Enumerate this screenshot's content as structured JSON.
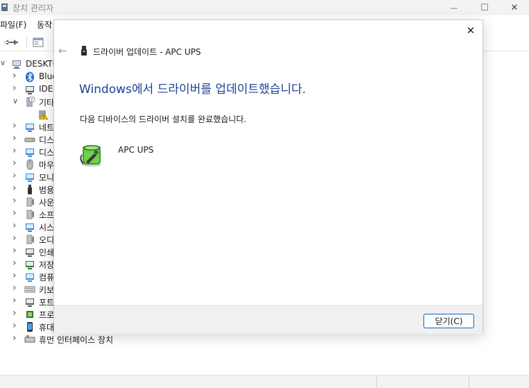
{
  "window": {
    "title": "장치 관리자",
    "minimize_glyph": "—",
    "maximize_glyph": "☐",
    "close_glyph": "✕"
  },
  "menu": [
    "파일(F)",
    "동작"
  ],
  "tree": {
    "root": "DESKTO",
    "items": [
      {
        "label": "Blue",
        "icon": "bluetooth-icon",
        "expanded": false
      },
      {
        "label": "IDE",
        "icon": "ide-controller-icon",
        "expanded": false
      },
      {
        "label": "기타",
        "icon": "other-devices-icon",
        "expanded": true
      },
      {
        "label": "",
        "icon": "unknown-device-warning-icon",
        "child": true
      },
      {
        "label": "네트",
        "icon": "network-adapter-icon",
        "expanded": false
      },
      {
        "label": "디스",
        "icon": "disk-drive-icon",
        "expanded": false
      },
      {
        "label": "디스",
        "icon": "display-adapter-icon",
        "expanded": false
      },
      {
        "label": "마우",
        "icon": "mouse-icon",
        "expanded": false
      },
      {
        "label": "모니",
        "icon": "monitor-icon",
        "expanded": false
      },
      {
        "label": "범용",
        "icon": "usb-controller-icon",
        "expanded": false
      },
      {
        "label": "사운",
        "icon": "audio-icon",
        "expanded": false
      },
      {
        "label": "소프",
        "icon": "software-device-icon",
        "expanded": false
      },
      {
        "label": "시스",
        "icon": "system-device-icon",
        "expanded": false
      },
      {
        "label": "오디",
        "icon": "audio-io-icon",
        "expanded": false
      },
      {
        "label": "인쇄",
        "icon": "printer-icon",
        "expanded": false
      },
      {
        "label": "저장",
        "icon": "storage-controller-icon",
        "expanded": false
      },
      {
        "label": "컴퓨",
        "icon": "computer-icon",
        "expanded": false
      },
      {
        "label": "키보",
        "icon": "keyboard-icon",
        "expanded": false
      },
      {
        "label": "포트",
        "icon": "port-icon",
        "expanded": false
      },
      {
        "label": "프로",
        "icon": "processor-icon",
        "expanded": false
      },
      {
        "label": "휴대",
        "icon": "portable-device-icon",
        "expanded": false
      },
      {
        "label": "휴먼 인터페이스 장치",
        "icon": "hid-icon",
        "expanded": false
      }
    ]
  },
  "dialog": {
    "header_title": "드라이버 업데이트 - APC UPS",
    "heading": "Windows에서 드라이버를 업데이트했습니다.",
    "message": "다음 디바이스의 드라이버 설치를 완료했습니다.",
    "device_name": "APC UPS",
    "close_button_label": "닫기(C)",
    "close_x_glyph": "✕",
    "back_glyph": "←"
  },
  "colors": {
    "heading": "#1c3f94",
    "accent_border": "#0067c0"
  }
}
